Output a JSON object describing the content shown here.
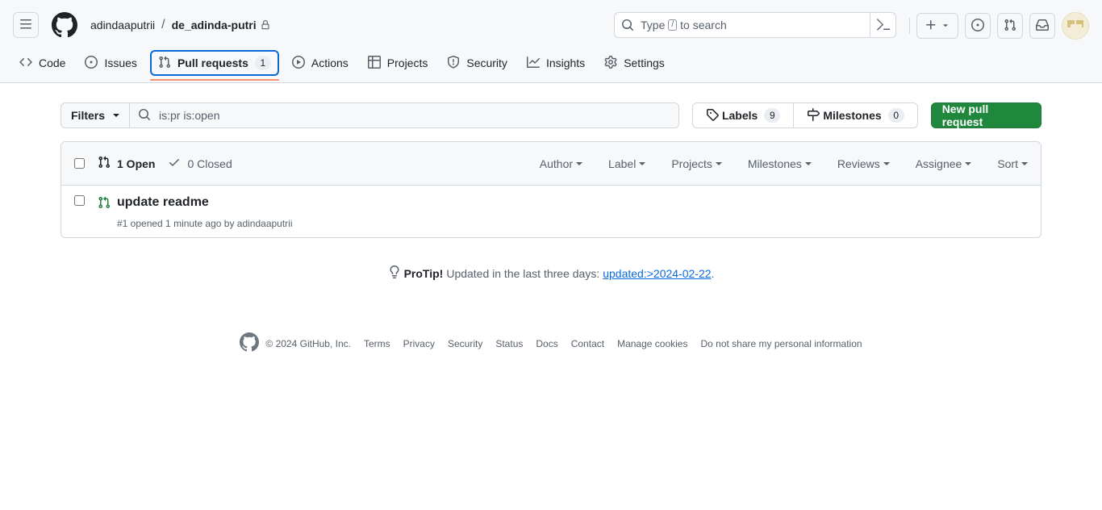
{
  "header": {
    "owner": "adindaaputrii",
    "separator": "/",
    "repo": "de_adinda-putri",
    "search": {
      "prefix": "Type",
      "key": "/",
      "suffix": "to search"
    }
  },
  "nav": {
    "tabs": [
      {
        "label": "Code",
        "icon": "code-icon"
      },
      {
        "label": "Issues",
        "icon": "issue-icon"
      },
      {
        "label": "Pull requests",
        "icon": "git-pull-request-icon",
        "count": "1",
        "active": true
      },
      {
        "label": "Actions",
        "icon": "play-icon"
      },
      {
        "label": "Projects",
        "icon": "table-icon"
      },
      {
        "label": "Security",
        "icon": "shield-icon"
      },
      {
        "label": "Insights",
        "icon": "graph-icon"
      },
      {
        "label": "Settings",
        "icon": "gear-icon"
      }
    ]
  },
  "toolbar": {
    "filters_label": "Filters",
    "filter_value": "is:pr is:open",
    "labels_label": "Labels",
    "labels_count": "9",
    "milestones_label": "Milestones",
    "milestones_count": "0",
    "new_pr_label": "New pull request"
  },
  "list": {
    "open_label": "1 Open",
    "closed_label": "0 Closed",
    "sorters": [
      "Author",
      "Label",
      "Projects",
      "Milestones",
      "Reviews",
      "Assignee",
      "Sort"
    ],
    "items": [
      {
        "title": "update readme",
        "meta": "#1 opened 1 minute ago by adindaaputrii"
      }
    ]
  },
  "protip": {
    "lead": "ProTip!",
    "text": "Updated in the last three days:",
    "link": "updated:>2024-02-22",
    "end": "."
  },
  "footer": {
    "copyright": "© 2024 GitHub, Inc.",
    "links": [
      "Terms",
      "Privacy",
      "Security",
      "Status",
      "Docs",
      "Contact",
      "Manage cookies",
      "Do not share my personal information"
    ]
  },
  "colors": {
    "accent": "#0969da",
    "success": "#1f883d",
    "underline": "#fd8c73"
  }
}
